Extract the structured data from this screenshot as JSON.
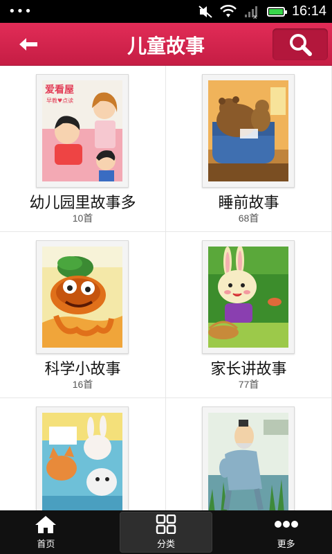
{
  "status_bar": {
    "time": "16:14",
    "battery_level": 0.9,
    "icons": [
      "more-dots-icon",
      "mute-icon",
      "wifi-icon",
      "signal-icon",
      "battery-icon"
    ]
  },
  "header": {
    "title": "儿童故事",
    "back_icon": "back-arrow-icon",
    "search_icon": "search-icon"
  },
  "categories": [
    {
      "name": "幼儿园里故事多",
      "count": "10首",
      "cover_label": "爱看屋",
      "cover_sublabel": "早教♥点读"
    },
    {
      "name": "睡前故事",
      "count": "68首"
    },
    {
      "name": "科学小故事",
      "count": "16首"
    },
    {
      "name": "家长讲故事",
      "count": "77首"
    },
    {
      "name": "",
      "count": ""
    },
    {
      "name": "",
      "count": ""
    }
  ],
  "bottom_nav": [
    {
      "label": "首页",
      "icon": "home-icon",
      "active": false
    },
    {
      "label": "分类",
      "icon": "grid-icon",
      "active": true
    },
    {
      "label": "更多",
      "icon": "more-icon",
      "active": false
    }
  ],
  "colors": {
    "header": "#d4234c",
    "search_button": "#b3173c",
    "bottom_bar": "#111111"
  }
}
